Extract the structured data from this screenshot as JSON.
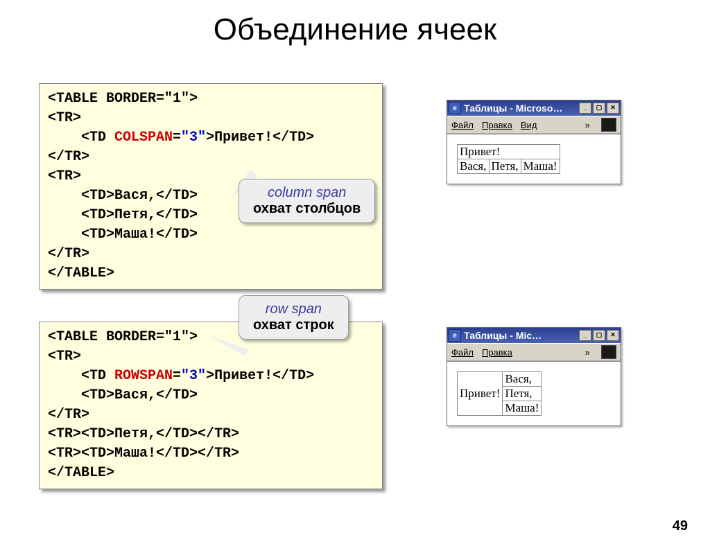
{
  "title": "Объединение ячеек",
  "code1": {
    "l1a": "<TABLE BORDER=\"1\">",
    "l2": "<TR>",
    "l3a": "    <TD ",
    "l3b": "COLSPAN",
    "l3c": "=",
    "l3d": "\"3\"",
    "l3e": ">Привет!</TD>",
    "l4": "</TR>",
    "l5": "<TR>",
    "l6": "    <TD>Вася,</TD>",
    "l7": "    <TD>Петя,</TD>",
    "l8": "    <TD>Маша!</TD>",
    "l9": "</TR>",
    "l10": "</TABLE>"
  },
  "code2": {
    "l1": "<TABLE BORDER=\"1\">",
    "l2": "<TR>",
    "l3a": "    <TD ",
    "l3b": "ROWSPAN",
    "l3c": "=",
    "l3d": "\"3\"",
    "l3e": ">Привет!</TD>",
    "l4": "    <TD>Вася,</TD>",
    "l5": "</TR>",
    "l6": "<TR><TD>Петя,</TD></TR>",
    "l7": "<TR><TD>Маша!</TD></TR>",
    "l8": "</TABLE>"
  },
  "callout1": {
    "line1": "column span",
    "line2": "охват столбцов"
  },
  "callout2": {
    "line1": "row span",
    "line2": "охват строк"
  },
  "win1": {
    "title": "Таблицы - Microso…",
    "menu": {
      "file": "Файл",
      "edit": "Правка",
      "view": "Вид",
      "chev": "»"
    },
    "table": {
      "r1c1": "Привет!",
      "r2c1": "Вася,",
      "r2c2": "Петя,",
      "r2c3": "Маша!"
    }
  },
  "win2": {
    "title": "Таблицы - Mic…",
    "menu": {
      "file": "Файл",
      "edit": "Правка",
      "chev": "»"
    },
    "table": {
      "c1": "Привет!",
      "r1": "Вася,",
      "r2": "Петя,",
      "r3": "Маша!"
    }
  },
  "page_number": "49"
}
